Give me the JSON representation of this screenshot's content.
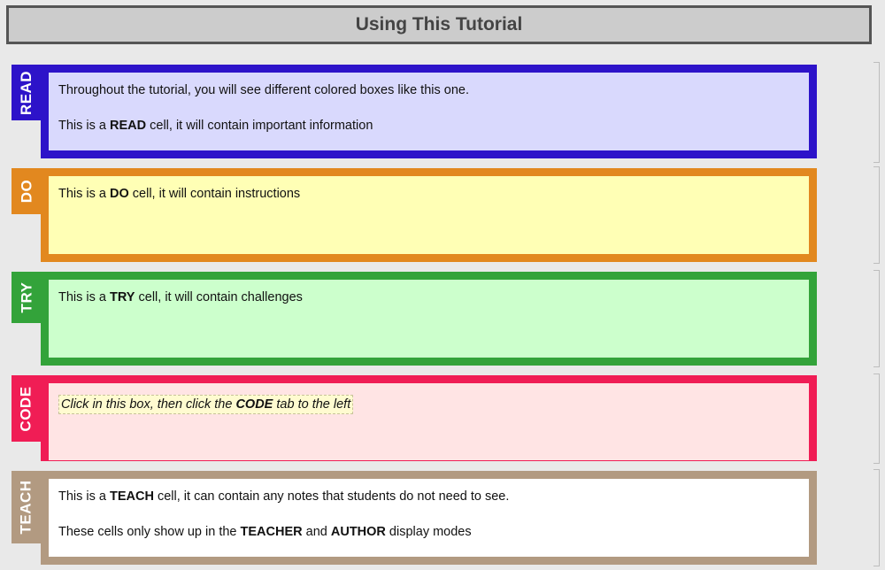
{
  "title": "Using This Tutorial",
  "cells": [
    {
      "type": "read",
      "tab_label": "READ",
      "colors": {
        "border": "#2d13c9",
        "bg": "#d9d9fd"
      },
      "line1": {
        "text": "Throughout the tutorial, you will see different colored boxes like this one."
      },
      "line2": {
        "pre": "This is a ",
        "bold": "READ",
        "post": " cell, it will contain important information"
      }
    },
    {
      "type": "do",
      "tab_label": "DO",
      "colors": {
        "border": "#e2881f",
        "bg": "#ffffb5"
      },
      "line1": {
        "pre": "This is a ",
        "bold": "DO",
        "post": " cell, it will contain instructions"
      }
    },
    {
      "type": "try",
      "tab_label": "TRY",
      "colors": {
        "border": "#33a33a",
        "bg": "#ccffcc"
      },
      "line1": {
        "pre": "This is a ",
        "bold": "TRY",
        "post": " cell, it will contain challenges"
      }
    },
    {
      "type": "code",
      "tab_label": "CODE",
      "colors": {
        "border": "#f01d55",
        "bg": "#ffe4e4"
      },
      "line1": {
        "pre": "Click in this box, then click the ",
        "bold": "CODE",
        "post": " tab to the left"
      }
    },
    {
      "type": "teach",
      "tab_label": "TEACH",
      "colors": {
        "border": "#b29a81",
        "bg": "#ffffff"
      },
      "line1": {
        "pre": "This is a ",
        "bold": "TEACH",
        "post": " cell, it can contain any notes that students do not need to see."
      },
      "line2": {
        "pre": "These cells only show up in the ",
        "bold": "TEACHER",
        "mid": " and ",
        "bold2": "AUTHOR",
        "post": " display modes"
      }
    }
  ]
}
